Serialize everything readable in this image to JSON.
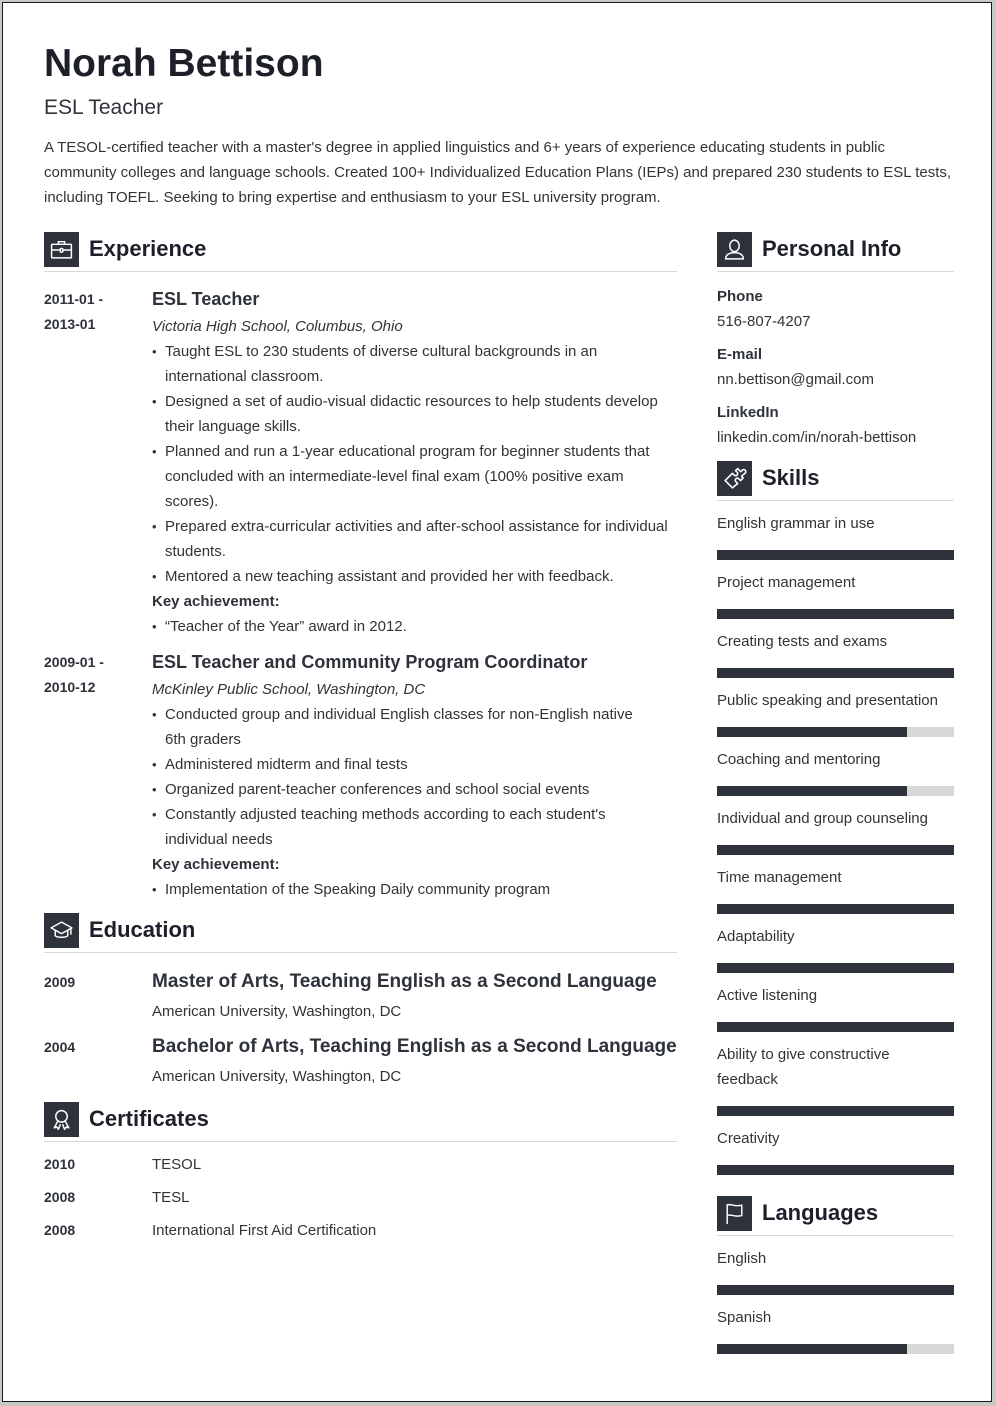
{
  "header": {
    "name": "Norah Bettison",
    "title": "ESL Teacher",
    "summary": "A TESOL-certified teacher with a master's degree in applied linguistics and 6+ years of experience educating students in public community colleges and language schools. Created 100+ Individualized Education Plans (IEPs) and prepared 230 students to ESL tests, including TOEFL. Seeking to bring expertise and enthusiasm to your ESL university program."
  },
  "colors": {
    "accent": "#2e323b",
    "bar_track": "#d8d8d8",
    "divider": "#d9d9d9"
  },
  "experience": {
    "heading": "Experience",
    "icon": "briefcase-icon",
    "jobs": [
      {
        "date_start": "2011-01 -",
        "date_end": "2013-01",
        "role": "ESL Teacher",
        "org": "Victoria High School, Columbus, Ohio",
        "bullets": [
          "Taught ESL to 230 students of diverse cultural backgrounds in an international classroom.",
          "Designed a set of audio-visual didactic resources to help students develop their language skills.",
          "Planned and run a 1-year educational program for beginner students that concluded with an intermediate-level final exam (100% positive exam scores).",
          "Prepared extra-curricular activities and after-school assistance for individual students.",
          "Mentored a new teaching assistant and provided her with feedback."
        ],
        "key_label": "Key achievement:",
        "key_items": [
          "“Teacher of the Year” award in 2012."
        ]
      },
      {
        "date_start": "2009-01 -",
        "date_end": "2010-12",
        "role": "ESL Teacher and Community Program Coordinator",
        "org": "McKinley Public School, Washington, DC",
        "bullets": [
          "Conducted group and individual English classes for non-English native 6th graders",
          "Administered midterm and final tests",
          "Organized parent-teacher conferences and school social events",
          "Constantly adjusted teaching methods according to each student's individual needs"
        ],
        "key_label": "Key achievement:",
        "key_items": [
          "Implementation of the Speaking Daily community program"
        ]
      }
    ]
  },
  "education": {
    "heading": "Education",
    "icon": "graduation-cap-icon",
    "items": [
      {
        "year": "2009",
        "degree": "Master of Arts, Teaching English as a Second Language",
        "school": "American University, Washington, DC"
      },
      {
        "year": "2004",
        "degree": "Bachelor of Arts, Teaching English as a Second Language",
        "school": "American University, Washington, DC"
      }
    ]
  },
  "certificates": {
    "heading": "Certificates",
    "icon": "award-ribbon-icon",
    "items": [
      {
        "year": "2010",
        "name": "TESOL"
      },
      {
        "year": "2008",
        "name": "TESL"
      },
      {
        "year": "2008",
        "name": "International First Aid Certification"
      }
    ]
  },
  "personal_info": {
    "heading": "Personal Info",
    "icon": "user-icon",
    "fields": [
      {
        "label": "Phone",
        "value": "516-807-4207"
      },
      {
        "label": "E-mail",
        "value": "nn.bettison@gmail.com"
      },
      {
        "label": "LinkedIn",
        "value": "linkedin.com/in/norah-bettison"
      }
    ]
  },
  "skills": {
    "heading": "Skills",
    "icon": "puzzle-piece-icon",
    "items": [
      {
        "name": "English grammar in use",
        "level": 1.0
      },
      {
        "name": "Project management",
        "level": 1.0
      },
      {
        "name": "Creating tests and exams",
        "level": 1.0
      },
      {
        "name": "Public speaking and presentation",
        "level": 0.8
      },
      {
        "name": "Coaching and mentoring",
        "level": 0.8
      },
      {
        "name": "Individual and group counseling",
        "level": 1.0
      },
      {
        "name": "Time management",
        "level": 1.0
      },
      {
        "name": "Adaptability",
        "level": 1.0
      },
      {
        "name": "Active listening",
        "level": 1.0
      },
      {
        "name": "Ability to give constructive feedback",
        "level": 1.0
      },
      {
        "name": "Creativity",
        "level": 1.0
      }
    ]
  },
  "languages": {
    "heading": "Languages",
    "icon": "flag-icon",
    "items": [
      {
        "name": "English",
        "level": 1.0
      },
      {
        "name": "Spanish",
        "level": 0.8
      }
    ]
  }
}
